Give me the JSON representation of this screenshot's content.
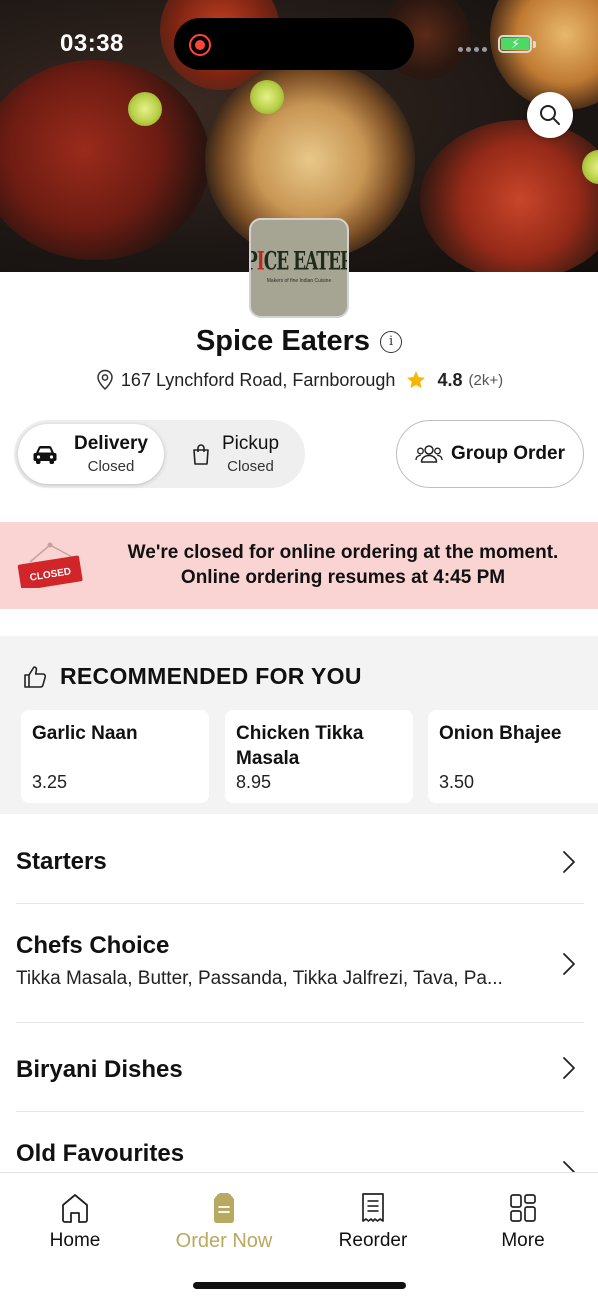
{
  "status_bar": {
    "time": "03:38"
  },
  "restaurant": {
    "logo_text_1": "SP",
    "logo_text_2": "I",
    "logo_text_3": "CE EATERS",
    "logo_subtitle": "Makers of fine Indian Cuisine",
    "name": "Spice Eaters",
    "address": "167 Lynchford Road, Farnborough",
    "rating": "4.8",
    "rating_count": "(2k+)"
  },
  "order_mode": {
    "delivery": {
      "label": "Delivery",
      "status": "Closed"
    },
    "pickup": {
      "label": "Pickup",
      "status": "Closed"
    },
    "group_order_label": "Group Order"
  },
  "closed_banner": {
    "sign_text": "CLOSED",
    "line1": "We're closed for online ordering at the moment.",
    "line2": "Online ordering resumes at 4:45 PM"
  },
  "recommended": {
    "title": "RECOMMENDED FOR YOU",
    "items": [
      {
        "name": "Garlic Naan",
        "price": "3.25"
      },
      {
        "name": "Chicken Tikka Masala",
        "price": "8.95"
      },
      {
        "name": "Onion Bhajee",
        "price": "3.50"
      }
    ]
  },
  "categories": [
    {
      "title": "Starters",
      "description": ""
    },
    {
      "title": "Chefs Choice",
      "description": "Tikka Masala, Butter, Passanda, Tikka Jalfrezi, Tava, Pa..."
    },
    {
      "title": "Biryani Dishes",
      "description": ""
    },
    {
      "title": "Old Favourites",
      "description": ""
    }
  ],
  "tabbar": {
    "items": [
      {
        "label": "Home",
        "icon": "home-icon"
      },
      {
        "label": "Order Now",
        "icon": "order-bag-icon"
      },
      {
        "label": "Reorder",
        "icon": "receipt-icon"
      },
      {
        "label": "More",
        "icon": "grid-icon"
      }
    ],
    "active": "Order Now"
  },
  "colors": {
    "accent": "#b8a960",
    "closed_banner_bg": "#f9d4d3",
    "closed_sign": "#d2252a",
    "rating_star": "#f5b800"
  }
}
